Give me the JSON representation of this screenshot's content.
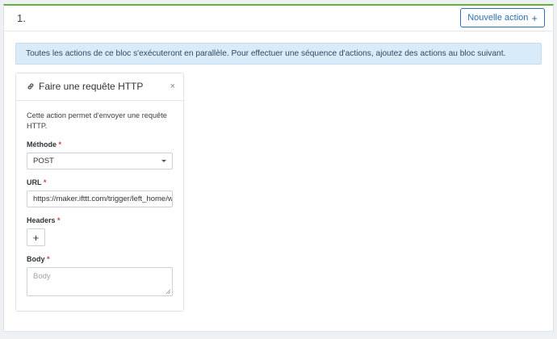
{
  "block": {
    "number": "1.",
    "new_action_label": "Nouvelle action",
    "new_action_icon": "plus-icon",
    "info_text": "Toutes les actions de ce bloc s'exécuteront en parallèle. Pour effectuer une séquence d'actions, ajoutez des actions au bloc suivant."
  },
  "card": {
    "icon": "link-icon",
    "title": "Faire une requête HTTP",
    "close": "×",
    "description": "Cette action permet d'envoyer une requête HTTP.",
    "method_label": "Méthode",
    "method_value": "POST",
    "url_label": "URL",
    "url_value": "https://maker.ifttt.com/trigger/left_home/w",
    "headers_label": "Headers",
    "headers_add": "+",
    "body_label": "Body",
    "body_placeholder": "Body",
    "required_mark": "*"
  },
  "colors": {
    "accent_top_border": "#5fb236",
    "button_blue": "#2d6db3",
    "info_bg": "#d9ebf8",
    "required_red": "#d23c3c"
  }
}
